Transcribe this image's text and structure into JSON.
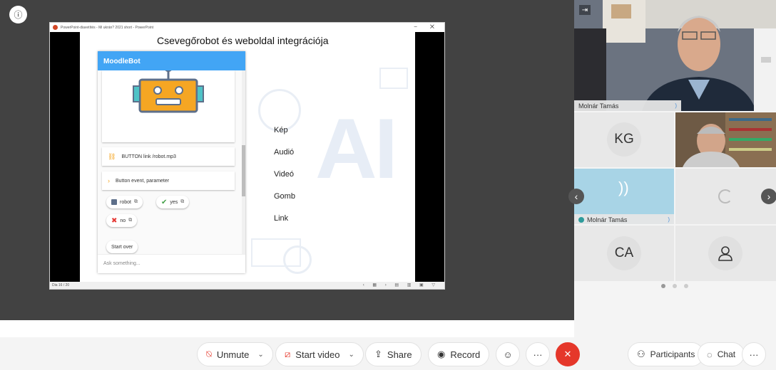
{
  "ppt": {
    "titlebar": "PowerPoint-diavetítés - Mi ukrán? 2021 short - PowerPoint",
    "statusbar": "Dia 16 / 20"
  },
  "slide": {
    "title": "Csevegőrobot és weboldal integrációja",
    "bg_text": "AI",
    "items": [
      "Kép",
      "Audió",
      "Videó",
      "Gomb",
      "Link"
    ]
  },
  "bot": {
    "header": "MoodleBot",
    "button_link": "BUTTON link /robot.mp3",
    "button_event": "Button event, parameter",
    "chips": [
      "robot",
      "yes",
      "no"
    ],
    "start_over": "Start over",
    "input_placeholder": "Ask something..."
  },
  "participants": {
    "main_name": "Molnár Tamás",
    "tile_names": [
      "Molnár Tamás"
    ],
    "initials": [
      "KG",
      "CA"
    ]
  },
  "toolbar": {
    "unmute": "Unmute",
    "start_video": "Start video",
    "share": "Share",
    "record": "Record",
    "more": "···",
    "participants": "Participants",
    "chat": "Chat"
  },
  "colors": {
    "bot_header": "#42a5f5",
    "end_call": "#e5372a",
    "mic_muted": "#e5372a",
    "audio_tile": "#a8d4e6"
  }
}
